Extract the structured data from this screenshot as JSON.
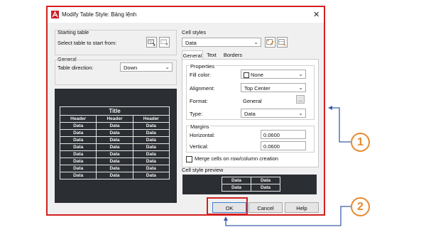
{
  "window": {
    "title": "Modify Table Style: Bảng lệnh",
    "close_glyph": "✕"
  },
  "starting_table": {
    "label": "Starting table",
    "select_label": "Select table to start from:"
  },
  "general": {
    "label": "General",
    "direction_label": "Table direction:",
    "direction_value": "Down"
  },
  "preview_table": {
    "title": "Title",
    "headers": [
      "Header",
      "Header",
      "Header"
    ],
    "row_cell": "Data",
    "row_count": 8
  },
  "cell_styles": {
    "label": "Cell styles",
    "value": "Data"
  },
  "tabs": [
    {
      "label": "General",
      "active": true
    },
    {
      "label": "Text",
      "active": false
    },
    {
      "label": "Borders",
      "active": false
    }
  ],
  "properties": {
    "label": "Properties",
    "fill_color_label": "Fill color:",
    "fill_color_value": "None",
    "alignment_label": "Alignment:",
    "alignment_value": "Top Center",
    "format_label": "Format:",
    "format_value": "General",
    "format_button": "...",
    "type_label": "Type:",
    "type_value": "Data"
  },
  "margins": {
    "label": "Margins",
    "horizontal_label": "Horizontal:",
    "horizontal_value": "0.0600",
    "vertical_label": "Vertical:",
    "vertical_value": "0.0600"
  },
  "merge_checkbox": {
    "label": "Merge cells on row/column creation",
    "checked": false
  },
  "cell_style_preview": {
    "label": "Cell style preview",
    "cell": "Data"
  },
  "buttons": {
    "ok": "OK",
    "cancel": "Cancel",
    "help": "Help"
  },
  "annotations": {
    "badge1": "1",
    "badge2": "2"
  },
  "colors": {
    "highlight": "#d41f1f",
    "arrow": "#3a5fa8",
    "badge": "#e8892e",
    "preview_bg": "#2b2e33"
  },
  "icons": [
    "autocad-app-icon",
    "close-icon",
    "select-table-icon",
    "table-style-icon",
    "new-cell-style-icon",
    "manage-cell-styles-icon",
    "chevron-down-icon",
    "checkbox-icon"
  ]
}
